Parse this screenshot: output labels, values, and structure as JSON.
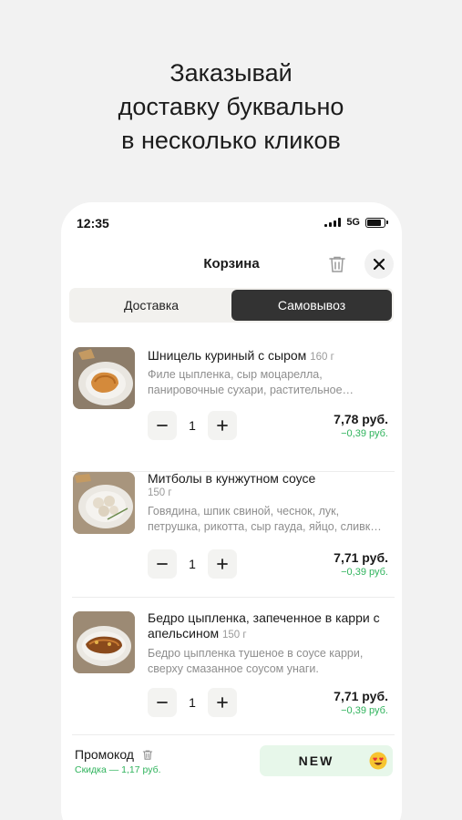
{
  "promo_headline": [
    "Заказывай",
    "доставку буквально",
    "в несколько кликов"
  ],
  "status_bar": {
    "time": "12:35",
    "network": "5G"
  },
  "cart": {
    "title": "Корзина",
    "tabs": [
      {
        "label": "Доставка",
        "active": false
      },
      {
        "label": "Самовывоз",
        "active": true
      }
    ],
    "items": [
      {
        "name": "Шницель куриный с сыром",
        "weight": "160 г",
        "description": "Филе цыпленка, сыр моцарелла, панировочные сухари, растительное…",
        "quantity": "1",
        "price": "7,78 руб.",
        "discount": "−0,39 руб."
      },
      {
        "name": "Митболы в кунжутном соусе",
        "weight": "150 г",
        "description": "Говядина, шпик свиной, чеснок, лук, петрушка, рикотта, сыр гауда, яйцо, сливк…",
        "quantity": "1",
        "price": "7,71 руб.",
        "discount": "−0,39 руб."
      },
      {
        "name": "Бедро цыпленка, запеченное в карри с апельсином",
        "weight": "150 г",
        "description": "Бедро цыпленка тушеное в соусе карри, сверху смазанное соусом унаги.",
        "quantity": "1",
        "price": "7,71 руб.",
        "discount": "−0,39 руб."
      }
    ],
    "promo": {
      "label": "Промокод",
      "discount_text": "Скидка — 1,17 руб.",
      "code": "NEW"
    }
  },
  "colors": {
    "accent_green": "#2fb35c",
    "active_tab": "#333333",
    "promo_background": "#e7f7ea"
  },
  "icons": [
    "trash-icon",
    "close-icon",
    "minus-icon",
    "plus-icon",
    "heart-eyes-emoji-icon",
    "signal-icon",
    "battery-icon"
  ]
}
